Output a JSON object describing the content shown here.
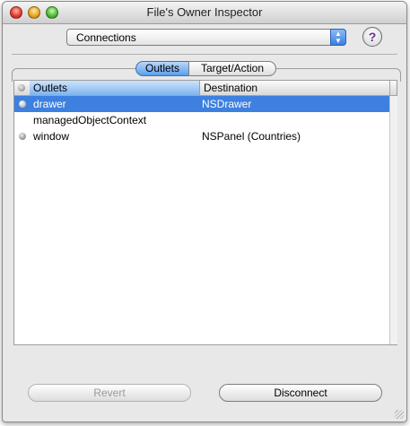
{
  "window": {
    "title": "File's Owner Inspector"
  },
  "popup": {
    "value": "Connections"
  },
  "help_button": {
    "label": "?"
  },
  "tabs": [
    {
      "label": "Outlets",
      "selected": true
    },
    {
      "label": "Target/Action",
      "selected": false
    }
  ],
  "table": {
    "columns": [
      "Outlets",
      "Destination"
    ],
    "rows": [
      {
        "outlet": "drawer",
        "destination": "NSDrawer",
        "connected": true,
        "selected": true
      },
      {
        "outlet": "managedObjectContext",
        "destination": "",
        "connected": false,
        "selected": false
      },
      {
        "outlet": "window",
        "destination": "NSPanel (Countries)",
        "connected": true,
        "selected": false
      }
    ]
  },
  "buttons": {
    "revert": "Revert",
    "disconnect": "Disconnect"
  },
  "colors": {
    "selection": "#3d80df",
    "accent": "#5b9ee9"
  }
}
